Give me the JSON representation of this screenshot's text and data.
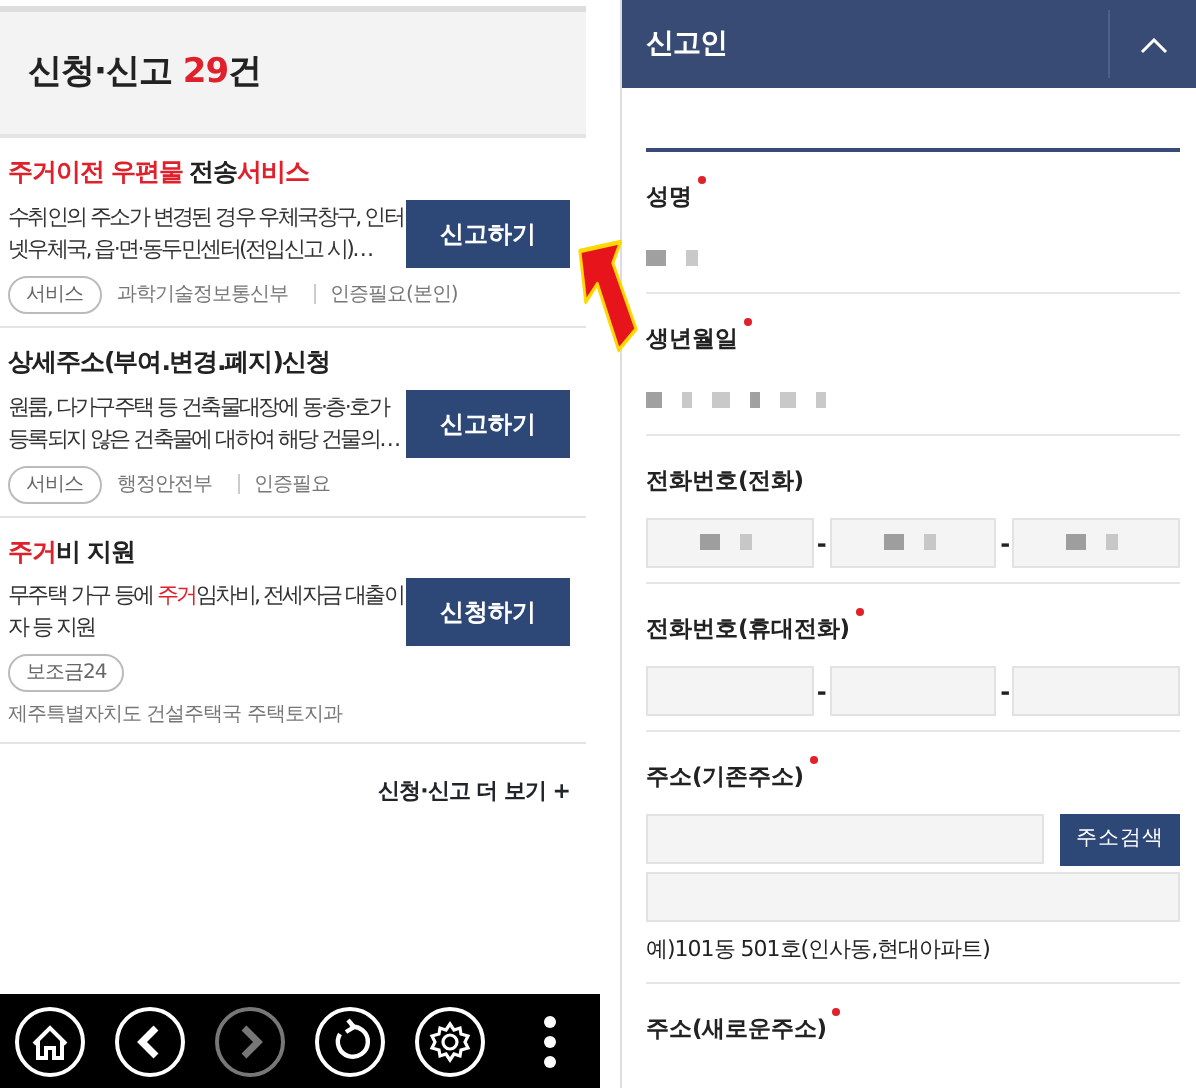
{
  "list_header": {
    "title": "신청·신고",
    "count": "29",
    "unit": "건"
  },
  "services": [
    {
      "title_parts": [
        {
          "text": "주거이전 우편물",
          "highlight": true
        },
        {
          "text": " 전송",
          "highlight": false
        },
        {
          "text": "서비스",
          "highlight": true
        }
      ],
      "description_parts": [
        {
          "text": "수취인의 주소가 변경된 경우 우체국창구, 인터넷우체국, 읍·면·동두민센터(전입신고 시)…",
          "highlight": false
        }
      ],
      "tag": "서비스",
      "agency": "과학기술정보통신부",
      "auth": "인증필요(본인)",
      "button": "신고하기"
    },
    {
      "title_parts": [
        {
          "text": "상세주소(부여.변경.폐지)신청",
          "highlight": false
        }
      ],
      "description_parts": [
        {
          "text": "원룸, 다가구주택 등 건축물대장에 동·층·호가 등록되지 않은 건축물에 대하여 해당 건물의…",
          "highlight": false
        }
      ],
      "tag": "서비스",
      "agency": "행정안전부",
      "auth": "인증필요",
      "button": "신고하기"
    },
    {
      "title_parts": [
        {
          "text": "주거",
          "highlight": true
        },
        {
          "text": "비 지원",
          "highlight": false
        }
      ],
      "description_parts": [
        {
          "text": "무주택 가구 등에 ",
          "highlight": false
        },
        {
          "text": "주거",
          "highlight": true
        },
        {
          "text": "임차비, 전세자금 대출이자 등 지원",
          "highlight": false
        }
      ],
      "tag": "보조금24",
      "agency_below": "제주특별자치도 건설주택국 주택토지과",
      "button": "신청하기"
    }
  ],
  "more_link": "신청·신고 더 보기",
  "more_icon": "+",
  "nav_buttons": [
    {
      "kind": "home",
      "disabled": false
    },
    {
      "kind": "back",
      "disabled": false
    },
    {
      "kind": "forward",
      "disabled": true
    },
    {
      "kind": "refresh",
      "disabled": false
    },
    {
      "kind": "settings",
      "disabled": false
    },
    {
      "kind": "more",
      "disabled": false
    }
  ],
  "section": {
    "title": "신고인",
    "expanded": true
  },
  "fields": [
    {
      "kind": "text",
      "label": "성명",
      "required": true,
      "masked": true
    },
    {
      "kind": "text",
      "label": "생년월일",
      "required": true,
      "masked": true
    },
    {
      "kind": "phone",
      "label": "전화번호(전화)",
      "required": false,
      "masked": true,
      "separators": [
        "-",
        "-"
      ]
    },
    {
      "kind": "phone",
      "label": "전화번호(휴대전화)",
      "required": true,
      "masked": false,
      "separators": [
        "-",
        "-"
      ]
    },
    {
      "kind": "address",
      "label": "주소(기존주소)",
      "required": true,
      "button": "주소검색",
      "hint": "예)101동 501호(인사동,현대아파트)"
    },
    {
      "kind": "label",
      "label": "주소(새로운주소)",
      "required": true
    }
  ]
}
